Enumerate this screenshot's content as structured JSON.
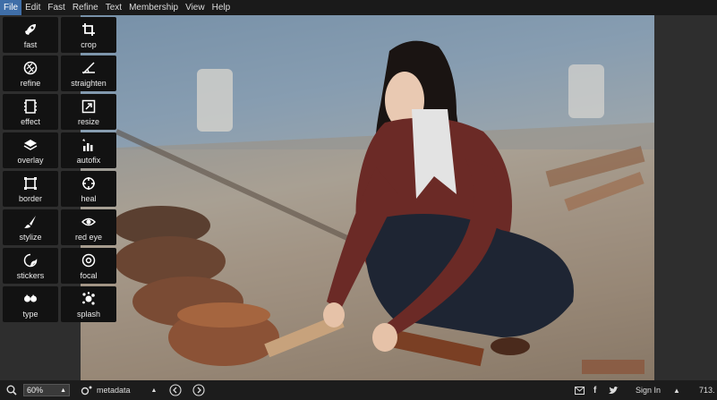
{
  "menu": {
    "items": [
      "File",
      "Edit",
      "Fast",
      "Refine",
      "Text",
      "Membership",
      "View",
      "Help"
    ],
    "active": "File"
  },
  "tools": [
    {
      "label": "fast",
      "icon": "rocket-icon"
    },
    {
      "label": "crop",
      "icon": "crop-icon"
    },
    {
      "label": "refine",
      "icon": "aperture-icon"
    },
    {
      "label": "straighten",
      "icon": "straighten-icon"
    },
    {
      "label": "effect",
      "icon": "film-icon"
    },
    {
      "label": "resize",
      "icon": "resize-icon"
    },
    {
      "label": "overlay",
      "icon": "layers-icon"
    },
    {
      "label": "autofix",
      "icon": "autofix-icon"
    },
    {
      "label": "border",
      "icon": "border-icon"
    },
    {
      "label": "heal",
      "icon": "crosshair-icon"
    },
    {
      "label": "stylize",
      "icon": "brush-icon"
    },
    {
      "label": "red eye",
      "icon": "eye-icon"
    },
    {
      "label": "stickers",
      "icon": "sticker-icon"
    },
    {
      "label": "focal",
      "icon": "focal-icon"
    },
    {
      "label": "type",
      "icon": "quote-icon"
    },
    {
      "label": "splash",
      "icon": "splash-icon"
    }
  ],
  "statusbar": {
    "zoom": "60%",
    "zoom_arrow": "▲",
    "metadata_label": "metadata",
    "metadata_arrow": "▲",
    "sign_in": "Sign In",
    "coordinate": "713.",
    "expand_arrow": "▲"
  },
  "colors": {
    "menu_active": "#3f6ea8",
    "tool_bg": "#121212",
    "panel_bg": "#2e2e2e"
  }
}
